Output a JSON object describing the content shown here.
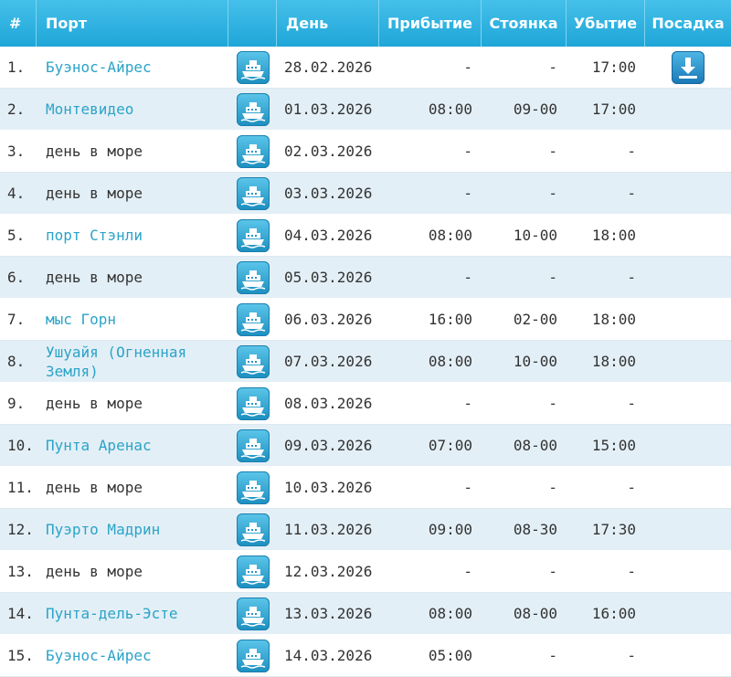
{
  "headers": {
    "num": "#",
    "port": "Порт",
    "day": "День",
    "arrival": "Прибытие",
    "stay": "Стоянка",
    "departure": "Убытие",
    "boarding": "Посадка"
  },
  "rows": [
    {
      "n": "1.",
      "port": "Буэнос-Айрес",
      "link": true,
      "date": "28.02.2026",
      "arrival": "-",
      "stay": "-",
      "departure": "17:00",
      "boarding": true
    },
    {
      "n": "2.",
      "port": "Монтевидео",
      "link": true,
      "date": "01.03.2026",
      "arrival": "08:00",
      "stay": "09-00",
      "departure": "17:00",
      "boarding": false
    },
    {
      "n": "3.",
      "port": "день в море",
      "link": false,
      "date": "02.03.2026",
      "arrival": "-",
      "stay": "-",
      "departure": "-",
      "boarding": false
    },
    {
      "n": "4.",
      "port": "день в море",
      "link": false,
      "date": "03.03.2026",
      "arrival": "-",
      "stay": "-",
      "departure": "-",
      "boarding": false
    },
    {
      "n": "5.",
      "port": "порт Стэнли",
      "link": true,
      "date": "04.03.2026",
      "arrival": "08:00",
      "stay": "10-00",
      "departure": "18:00",
      "boarding": false
    },
    {
      "n": "6.",
      "port": "день в море",
      "link": false,
      "date": "05.03.2026",
      "arrival": "-",
      "stay": "-",
      "departure": "-",
      "boarding": false
    },
    {
      "n": "7.",
      "port": "мыс Горн",
      "link": true,
      "date": "06.03.2026",
      "arrival": "16:00",
      "stay": "02-00",
      "departure": "18:00",
      "boarding": false
    },
    {
      "n": "8.",
      "port": "Ушуайя (Огненная Земля)",
      "link": true,
      "date": "07.03.2026",
      "arrival": "08:00",
      "stay": "10-00",
      "departure": "18:00",
      "boarding": false
    },
    {
      "n": "9.",
      "port": "день в море",
      "link": false,
      "date": "08.03.2026",
      "arrival": "-",
      "stay": "-",
      "departure": "-",
      "boarding": false
    },
    {
      "n": "10.",
      "port": "Пунта Аренас",
      "link": true,
      "date": "09.03.2026",
      "arrival": "07:00",
      "stay": "08-00",
      "departure": "15:00",
      "boarding": false
    },
    {
      "n": "11.",
      "port": "день в море",
      "link": false,
      "date": "10.03.2026",
      "arrival": "-",
      "stay": "-",
      "departure": "-",
      "boarding": false
    },
    {
      "n": "12.",
      "port": "Пуэрто Мадрин",
      "link": true,
      "date": "11.03.2026",
      "arrival": "09:00",
      "stay": "08-30",
      "departure": "17:30",
      "boarding": false
    },
    {
      "n": "13.",
      "port": "день в море",
      "link": false,
      "date": "12.03.2026",
      "arrival": "-",
      "stay": "-",
      "departure": "-",
      "boarding": false
    },
    {
      "n": "14.",
      "port": "Пунта-дель-Эсте",
      "link": true,
      "date": "13.03.2026",
      "arrival": "08:00",
      "stay": "08-00",
      "departure": "16:00",
      "boarding": false
    },
    {
      "n": "15.",
      "port": "Буэнос-Айрес",
      "link": true,
      "date": "14.03.2026",
      "arrival": "05:00",
      "stay": "-",
      "departure": "-",
      "boarding": false
    }
  ],
  "icons": {
    "ship": "ship-icon",
    "boarding": "download-icon"
  },
  "colors": {
    "header": "#1fa6d8",
    "link": "#2ba3c8",
    "row_alt": "#e3eff6"
  }
}
